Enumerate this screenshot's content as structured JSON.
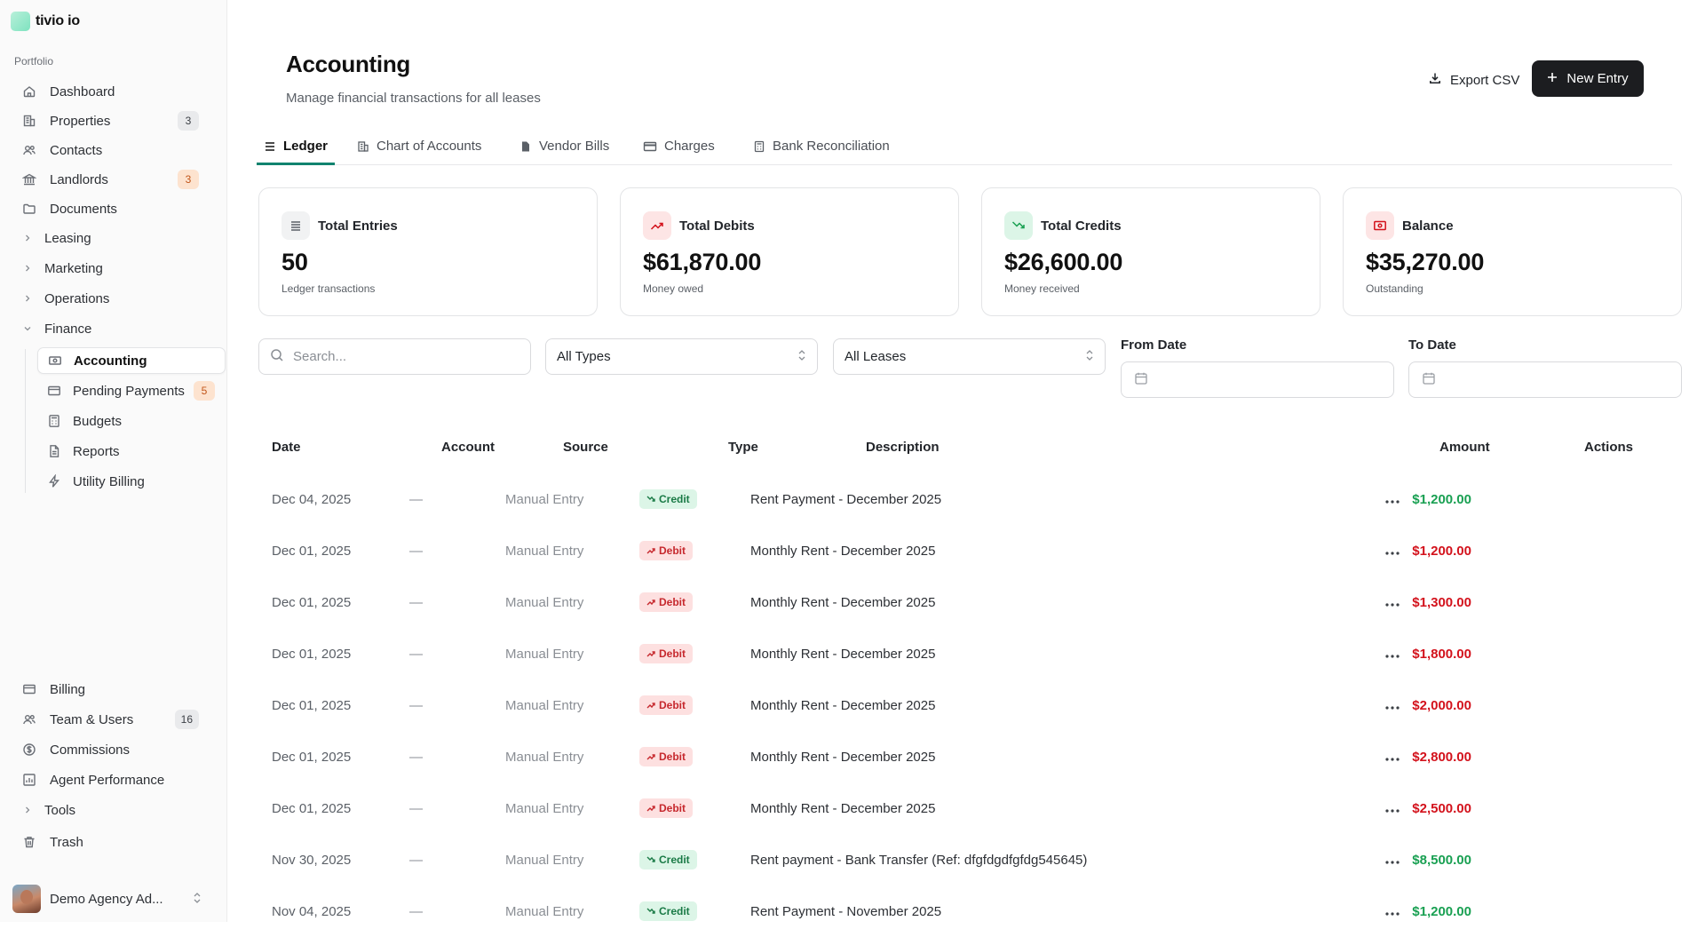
{
  "app": {
    "name": "tivio io"
  },
  "sidebar": {
    "section_label": "Portfolio",
    "items": [
      {
        "label": "Dashboard",
        "icon": "home-icon"
      },
      {
        "label": "Properties",
        "icon": "building-icon",
        "badge": "3"
      },
      {
        "label": "Contacts",
        "icon": "contacts-icon"
      },
      {
        "label": "Landlords",
        "icon": "bank-icon",
        "badge": "3"
      },
      {
        "label": "Documents",
        "icon": "folder-icon"
      },
      {
        "label": "Leasing",
        "icon": "chevron-right-icon"
      },
      {
        "label": "Marketing",
        "icon": "chevron-right-icon"
      },
      {
        "label": "Operations",
        "icon": "chevron-right-icon"
      },
      {
        "label": "Finance",
        "icon": "chevron-down-icon"
      }
    ],
    "finance_items": [
      {
        "label": "Accounting",
        "icon": "money-icon"
      },
      {
        "label": "Pending Payments",
        "icon": "credit-card-icon",
        "badge": "5"
      },
      {
        "label": "Budgets",
        "icon": "calculator-icon"
      },
      {
        "label": "Reports",
        "icon": "file-icon"
      },
      {
        "label": "Utility Billing",
        "icon": "bolt-icon"
      }
    ],
    "bottom_items": [
      {
        "label": "Billing",
        "icon": "credit-card-icon"
      },
      {
        "label": "Team & Users",
        "icon": "users-icon",
        "badge": "16"
      },
      {
        "label": "Commissions",
        "icon": "dollar-circle-icon"
      },
      {
        "label": "Agent Performance",
        "icon": "chart-icon"
      },
      {
        "label": "Tools",
        "icon": "chevron-right-icon"
      },
      {
        "label": "Trash",
        "icon": "trash-icon"
      }
    ],
    "user": {
      "name": "Demo Agency Ad..."
    }
  },
  "page": {
    "title": "Accounting",
    "subtitle": "Manage financial transactions for all leases",
    "export_label": "Export CSV",
    "new_entry_label": "New Entry"
  },
  "tabs": [
    "Ledger",
    "Chart of Accounts",
    "Vendor Bills",
    "Charges",
    "Bank Reconciliation"
  ],
  "stats": [
    {
      "title": "Total Entries",
      "value": "50",
      "note": "Ledger transactions",
      "color": "#f1f2f3"
    },
    {
      "title": "Total Debits",
      "value": "$61,870.00",
      "note": "Money owed",
      "color": "#fde5e5"
    },
    {
      "title": "Total Credits",
      "value": "$26,600.00",
      "note": "Money received",
      "color": "#dcf5e7"
    },
    {
      "title": "Balance",
      "value": "$35,270.00",
      "note": "Outstanding",
      "color": "#fde5e5"
    }
  ],
  "filters": {
    "search_placeholder": "Search...",
    "type_value": "All Types",
    "lease_value": "All Leases",
    "from_label": "From Date",
    "to_label": "To Date"
  },
  "table": {
    "columns": [
      "Date",
      "Account",
      "Source",
      "Type",
      "Description",
      "Amount",
      "Actions"
    ],
    "rows": [
      {
        "date": "Dec 04, 2025",
        "account": "—",
        "source": "Manual Entry",
        "type": "Credit",
        "description": "Rent Payment - December 2025",
        "amount": "$1,200.00"
      },
      {
        "date": "Dec 01, 2025",
        "account": "—",
        "source": "Manual Entry",
        "type": "Debit",
        "description": "Monthly Rent - December 2025",
        "amount": "$1,200.00"
      },
      {
        "date": "Dec 01, 2025",
        "account": "—",
        "source": "Manual Entry",
        "type": "Debit",
        "description": "Monthly Rent - December 2025",
        "amount": "$1,300.00"
      },
      {
        "date": "Dec 01, 2025",
        "account": "—",
        "source": "Manual Entry",
        "type": "Debit",
        "description": "Monthly Rent - December 2025",
        "amount": "$1,800.00"
      },
      {
        "date": "Dec 01, 2025",
        "account": "—",
        "source": "Manual Entry",
        "type": "Debit",
        "description": "Monthly Rent - December 2025",
        "amount": "$2,000.00"
      },
      {
        "date": "Dec 01, 2025",
        "account": "—",
        "source": "Manual Entry",
        "type": "Debit",
        "description": "Monthly Rent - December 2025",
        "amount": "$2,800.00"
      },
      {
        "date": "Dec 01, 2025",
        "account": "—",
        "source": "Manual Entry",
        "type": "Debit",
        "description": "Monthly Rent - December 2025",
        "amount": "$2,500.00"
      },
      {
        "date": "Nov 30, 2025",
        "account": "—",
        "source": "Manual Entry",
        "type": "Credit",
        "description": "Rent payment - Bank Transfer (Ref: dfgfdgdfgfdg545645)",
        "amount": "$8,500.00"
      },
      {
        "date": "Nov 04, 2025",
        "account": "—",
        "source": "Manual Entry",
        "type": "Credit",
        "description": "Rent Payment - November 2025",
        "amount": "$1,200.00"
      }
    ]
  },
  "colors": {
    "accent": "#11836f",
    "primary_button": "#1c1d20",
    "credit": "#19a052",
    "debit": "#d3121c"
  }
}
